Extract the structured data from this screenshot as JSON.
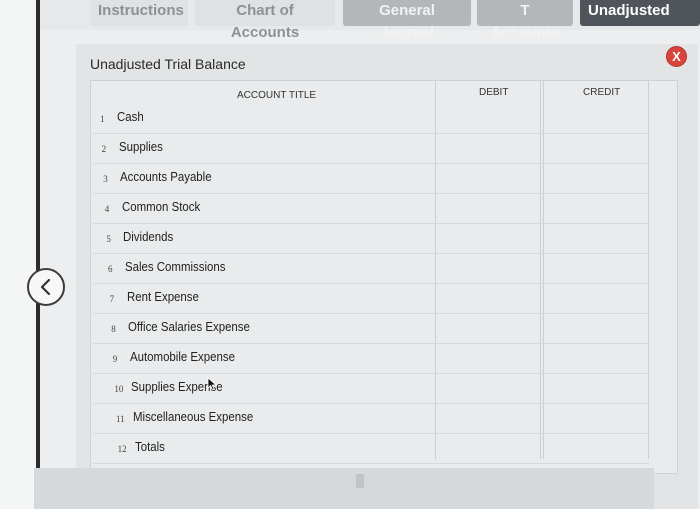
{
  "tabs": [
    {
      "label": "Instructions",
      "style": "light"
    },
    {
      "label": "Chart of Accounts",
      "style": "light"
    },
    {
      "label": "General Journal",
      "style": "gray"
    },
    {
      "label": "T Accounts",
      "style": "gray"
    },
    {
      "label": "Unadjusted Tria",
      "style": "dark"
    }
  ],
  "panel": {
    "title": "Unadjusted Trial Balance",
    "close_glyph": "X"
  },
  "table": {
    "headers": {
      "account": "ACCOUNT TITLE",
      "debit": "DEBIT",
      "credit": "CREDIT"
    },
    "rows": [
      {
        "num": "1",
        "title": "Cash"
      },
      {
        "num": "2",
        "title": "Supplies"
      },
      {
        "num": "3",
        "title": "Accounts Payable"
      },
      {
        "num": "4",
        "title": "Common Stock"
      },
      {
        "num": "5",
        "title": "Dividends"
      },
      {
        "num": "6",
        "title": "Sales Commissions"
      },
      {
        "num": "7",
        "title": "Rent Expense"
      },
      {
        "num": "8",
        "title": "Office Salaries Expense"
      },
      {
        "num": "9",
        "title": "Automobile Expense"
      },
      {
        "num": "10",
        "title": "Supplies Expense"
      },
      {
        "num": "11",
        "title": "Miscellaneous Expense"
      },
      {
        "num": "12",
        "title": "Totals"
      }
    ]
  },
  "colors": {
    "close": "#d8453b",
    "active_tab": "#50555b"
  },
  "icons": {
    "back": "chevron-left-icon",
    "close": "close-icon",
    "cursor": "mouse-pointer-icon"
  }
}
